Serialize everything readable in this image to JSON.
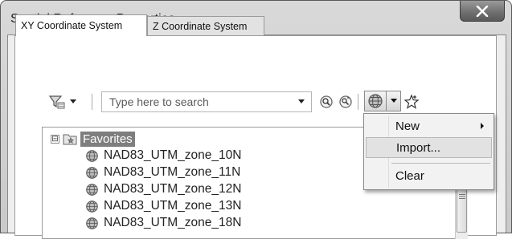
{
  "window": {
    "title": "Spatial Reference Properties"
  },
  "tabs": [
    {
      "label": "XY Coordinate System",
      "active": true
    },
    {
      "label": "Z Coordinate System",
      "active": false
    }
  ],
  "toolbar": {
    "search_placeholder": "Type here to search",
    "icons": [
      "filter-icon",
      "search-icon",
      "search-options-icon",
      "globe-icon",
      "star-icon"
    ]
  },
  "tree": {
    "root": {
      "label": "Favorites",
      "expander": "⊟"
    },
    "items": [
      {
        "label": "NAD83_UTM_zone_10N"
      },
      {
        "label": "NAD83_UTM_zone_11N"
      },
      {
        "label": "NAD83_UTM_zone_12N"
      },
      {
        "label": "NAD83_UTM_zone_13N"
      },
      {
        "label": "NAD83_UTM_zone_18N"
      }
    ]
  },
  "menu": {
    "items": [
      {
        "label": "New",
        "submenu": true
      },
      {
        "label": "Import...",
        "highlighted": true
      },
      {
        "label": "Clear"
      }
    ]
  },
  "colors": {
    "highlight": "#7e7e7e",
    "menu_bg": "#f2f2f2",
    "title_bg": "#d9d9d9"
  }
}
